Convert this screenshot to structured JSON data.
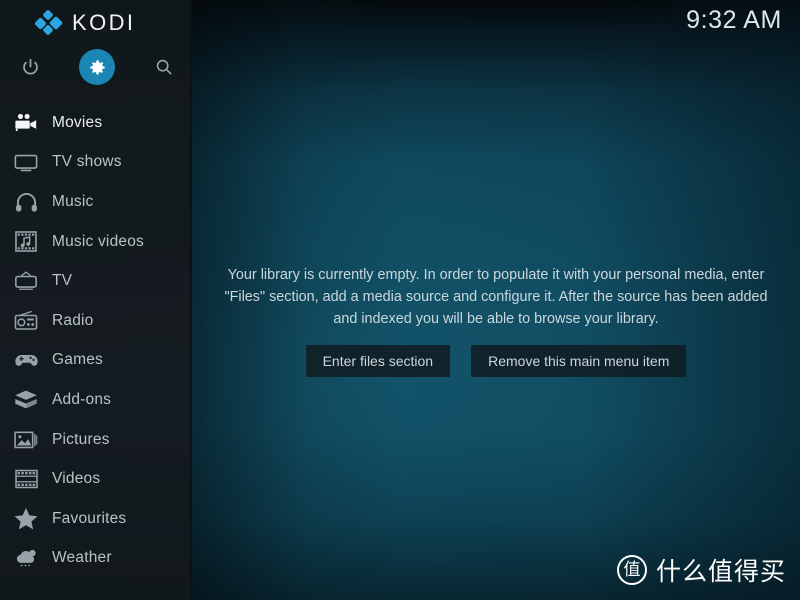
{
  "app": {
    "name": "KODI",
    "logo_icon": "kodi-diamond-logo",
    "accent_color": "#1b86b4",
    "logo_color": "#2ba5e0",
    "sidebar_bg": "#131a1e",
    "content_bg": "#104b60"
  },
  "topbar": {
    "clock": "9:32 AM",
    "actions": [
      {
        "name": "power",
        "icon": "power-icon",
        "label": "Power",
        "active": false
      },
      {
        "name": "settings",
        "icon": "gear-icon",
        "label": "Settings",
        "active": true
      },
      {
        "name": "search",
        "icon": "search-icon",
        "label": "Search",
        "active": false
      }
    ]
  },
  "sidebar": {
    "items": [
      {
        "label": "Movies",
        "icon": "movie-camera-icon",
        "selected": true
      },
      {
        "label": "TV shows",
        "icon": "television-icon",
        "selected": false
      },
      {
        "label": "Music",
        "icon": "headphones-icon",
        "selected": false
      },
      {
        "label": "Music videos",
        "icon": "film-music-icon",
        "selected": false
      },
      {
        "label": "TV",
        "icon": "tv-antenna-icon",
        "selected": false
      },
      {
        "label": "Radio",
        "icon": "radio-icon",
        "selected": false
      },
      {
        "label": "Games",
        "icon": "gamepad-icon",
        "selected": false
      },
      {
        "label": "Add-ons",
        "icon": "open-box-icon",
        "selected": false
      },
      {
        "label": "Pictures",
        "icon": "picture-icon",
        "selected": false
      },
      {
        "label": "Videos",
        "icon": "film-strip-icon",
        "selected": false
      },
      {
        "label": "Favourites",
        "icon": "star-icon",
        "selected": false
      },
      {
        "label": "Weather",
        "icon": "cloud-icon",
        "selected": false
      }
    ]
  },
  "main": {
    "empty_message": "Your library is currently empty. In order to populate it with your personal media, enter \"Files\" section, add a media source and configure it. After the source has been added and indexed you will be able to browse your library.",
    "buttons": [
      {
        "label": "Enter files section"
      },
      {
        "label": "Remove this main menu item"
      }
    ]
  },
  "watermark": {
    "badge_char": "值",
    "text": "什么值得买"
  }
}
